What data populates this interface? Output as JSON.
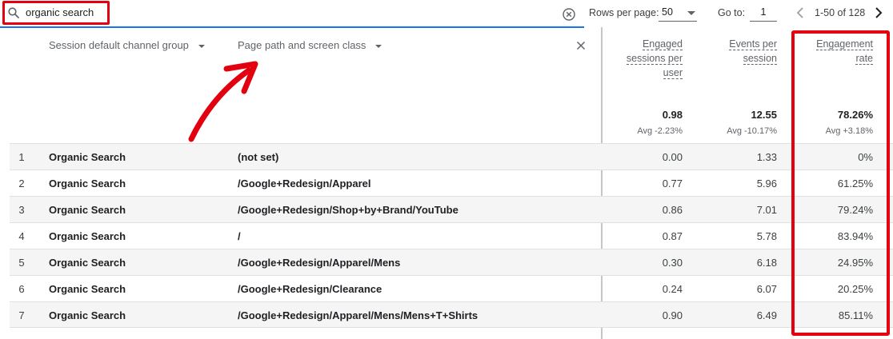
{
  "search": {
    "value": "organic search"
  },
  "pagination": {
    "rows_label": "Rows per page:",
    "rows_value": "50",
    "goto_label": "Go to:",
    "goto_value": "1",
    "range": "1-50 of 128"
  },
  "dimensions": {
    "channel_header": "Session default channel group",
    "path_header": "Page path and screen class"
  },
  "metrics": [
    {
      "line1": "Engaged",
      "line2": "sessions per",
      "line3": "user",
      "total": "0.98",
      "avg": "Avg -2.23%"
    },
    {
      "line1": "Events per",
      "line2": "session",
      "line3": "",
      "total": "12.55",
      "avg": "Avg -10.17%"
    },
    {
      "line1": "Engagement",
      "line2": "rate",
      "line3": "",
      "total": "78.26%",
      "avg": "Avg +3.18%"
    }
  ],
  "rows": [
    {
      "idx": "1",
      "channel": "Organic Search",
      "path": "(not set)",
      "m1": "0.00",
      "m2": "1.33",
      "m3": "0%"
    },
    {
      "idx": "2",
      "channel": "Organic Search",
      "path": "/Google+Redesign/Apparel",
      "m1": "0.77",
      "m2": "5.96",
      "m3": "61.25%"
    },
    {
      "idx": "3",
      "channel": "Organic Search",
      "path": "/Google+Redesign/Shop+by+Brand/YouTube",
      "m1": "0.86",
      "m2": "7.01",
      "m3": "79.24%"
    },
    {
      "idx": "4",
      "channel": "Organic Search",
      "path": "/",
      "m1": "0.87",
      "m2": "5.78",
      "m3": "83.94%"
    },
    {
      "idx": "5",
      "channel": "Organic Search",
      "path": "/Google+Redesign/Apparel/Mens",
      "m1": "0.30",
      "m2": "6.18",
      "m3": "24.95%"
    },
    {
      "idx": "6",
      "channel": "Organic Search",
      "path": "/Google+Redesign/Clearance",
      "m1": "0.24",
      "m2": "6.07",
      "m3": "20.25%"
    },
    {
      "idx": "7",
      "channel": "Organic Search",
      "path": "/Google+Redesign/Apparel/Mens/Mens+T+Shirts",
      "m1": "0.90",
      "m2": "6.49",
      "m3": "85.11%"
    }
  ],
  "icons": {
    "search": "search-icon",
    "clear": "clear-circle-icon",
    "prev": "chevron-left-icon",
    "next": "chevron-right-icon",
    "close": "close-icon",
    "annotation": "red-arrow-icon"
  },
  "colors": {
    "accent": "#1a73e8",
    "highlight": "#e3000f",
    "row_alt": "#f5f5f5"
  }
}
